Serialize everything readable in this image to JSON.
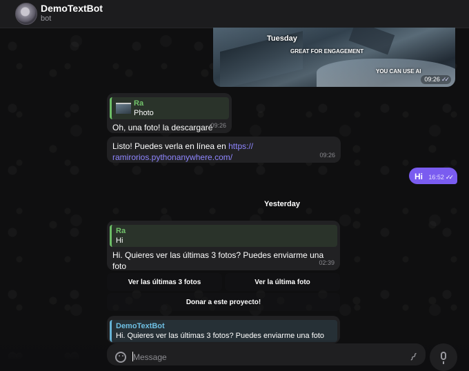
{
  "header": {
    "title": "DemoTextBot",
    "subtitle": "bot"
  },
  "image_message": {
    "caption_1": "Tuesday",
    "caption_2": "GREAT FOR ENGAGEMENT",
    "caption_3": "YOU CAN USE AI",
    "time": "09:26",
    "ticks": "✓✓"
  },
  "msg_photo_reply": {
    "reply_name": "Ra",
    "reply_body": "Photo",
    "text": "Oh, una foto! la descargaré",
    "time": "09:26"
  },
  "msg_link": {
    "text": "Listo! Puedes verla en línea en ",
    "link": "https://ramirorios.pythonanywhere.com/",
    "link_line1": "https://",
    "link_line2": "ramirorios.pythonanywhere.com/",
    "time": "09:26"
  },
  "msg_out": {
    "text": "Hi",
    "time": "16:52",
    "ticks": "✓✓"
  },
  "date_separator": "Yesterday",
  "msg_bot_reply": {
    "reply_name": "Ra",
    "reply_body": "Hi",
    "text": "Hi. Quieres ver las últimas 3 fotos? Puedes enviarme una foto",
    "time": "02:39"
  },
  "keyboard": {
    "btn_last3": "Ver las últimas 3 fotos",
    "btn_last": "Ver la última foto",
    "btn_donate": "Donar a este proyecto!"
  },
  "msg_partial": {
    "reply_name": "DemoTextBot",
    "reply_body": "Hi. Quieres ver las últimas 3 fotos? Puedes enviarme una foto"
  },
  "composer": {
    "placeholder": "Message"
  },
  "colors": {
    "accent": "#7a5cf0",
    "link": "#8f86ff",
    "reply_green": "#6dbf67",
    "reply_blue": "#66b3d6"
  }
}
